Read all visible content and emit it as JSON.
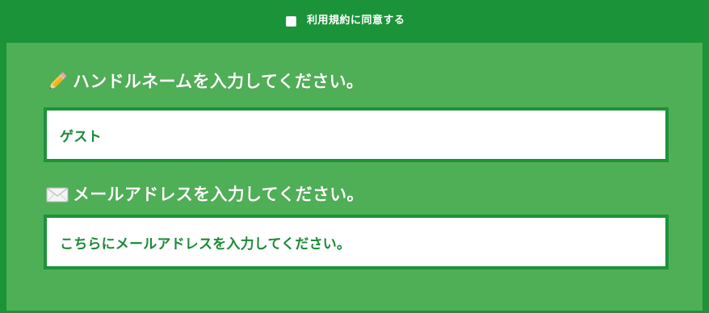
{
  "agreement": {
    "label": "利用規約に同意する",
    "checked": false
  },
  "name_section": {
    "icon": "pencil-icon",
    "heading": "ハンドルネームを入力してください。",
    "value": "ゲスト"
  },
  "mail_section": {
    "icon": "envelope-icon",
    "heading": "メールアドレスを入力してください。",
    "placeholder": "こちらにメールアドレスを入力してください。",
    "value": ""
  },
  "colors": {
    "frame_green": "#1b9339",
    "panel_green": "#4faf56",
    "text_green": "#1b8a35",
    "white": "#ffffff"
  }
}
